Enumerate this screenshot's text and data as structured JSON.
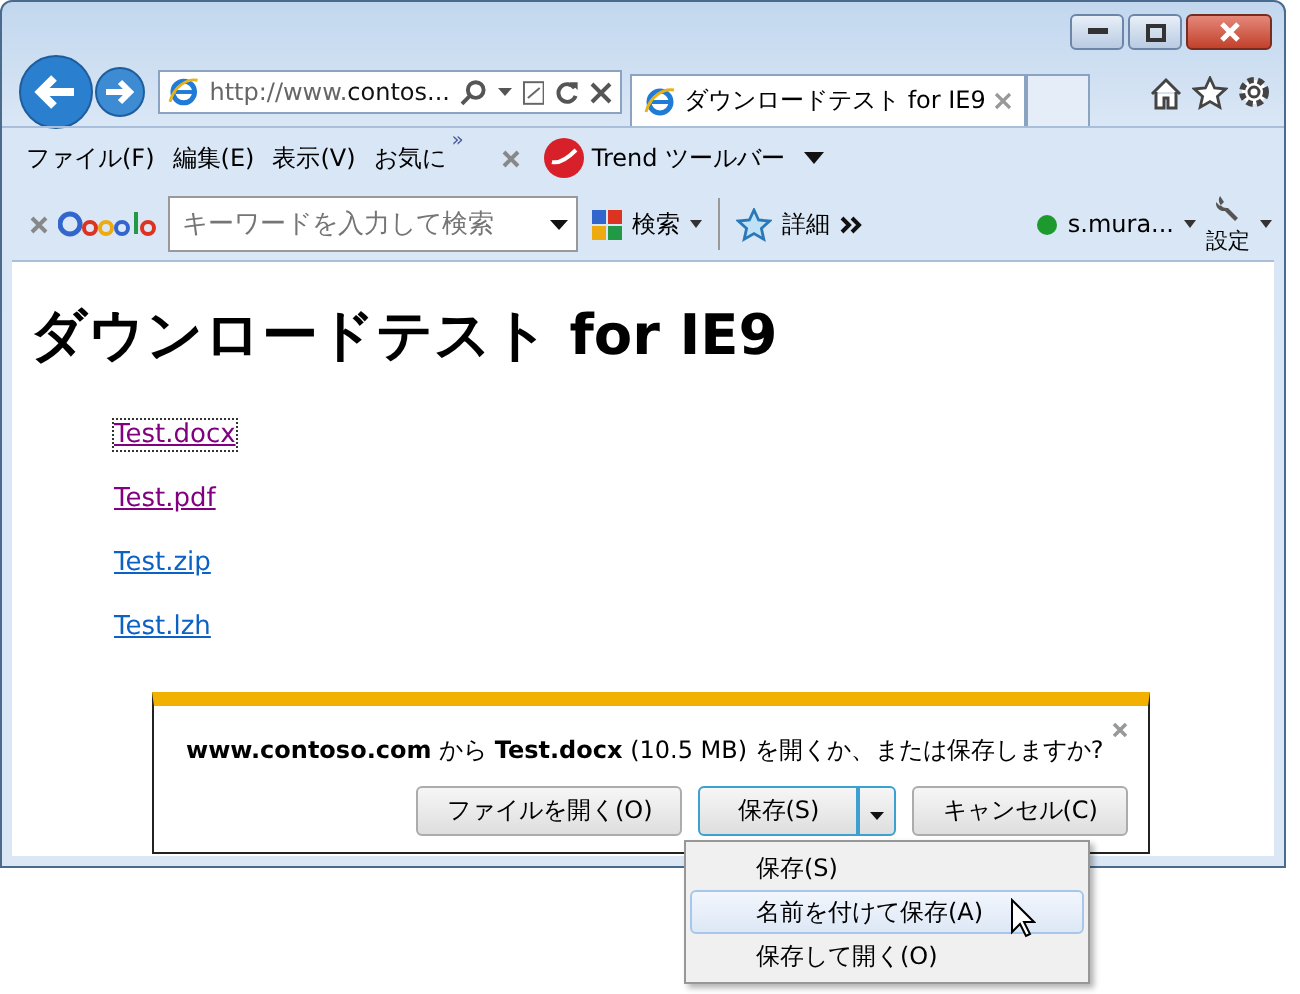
{
  "address_bar": {
    "scheme": "http://www.",
    "domain": "contos..."
  },
  "tabs": [
    {
      "title": "ダウンロードテスト for IE9",
      "selected": true
    }
  ],
  "menu_bar": {
    "items": [
      "ファイル(F)",
      "編集(E)",
      "表示(V)",
      "お気に"
    ],
    "overflow": "»",
    "toolbar_name": "Trend ツールバー"
  },
  "google_toolbar": {
    "search": {
      "placeholder": "キーワードを入力して検索"
    },
    "search_button": "検索",
    "details": "詳細",
    "account": "s.mura...",
    "settings": "設定"
  },
  "page": {
    "heading": "ダウンロードテスト for IE9",
    "links": [
      {
        "text": "Test.docx",
        "visited": true,
        "focused": true
      },
      {
        "text": "Test.pdf",
        "visited": true,
        "focused": false
      },
      {
        "text": "Test.zip",
        "visited": false,
        "focused": false
      },
      {
        "text": "Test.lzh",
        "visited": false,
        "focused": false
      }
    ]
  },
  "notification": {
    "message": "**www.contoso.com** から **Test.docx** (10.5 MB) を開くか、または保存しますか?",
    "open_button": "ファイルを開く(O)",
    "save_button": "保存(S)",
    "cancel_button": "キャンセル(C)"
  },
  "save_menu": [
    {
      "label": "保存(S)",
      "selected": false
    },
    {
      "label": "名前を付けて保存(A)",
      "selected": true
    },
    {
      "label": "保存して開く(O)",
      "selected": false
    }
  ]
}
